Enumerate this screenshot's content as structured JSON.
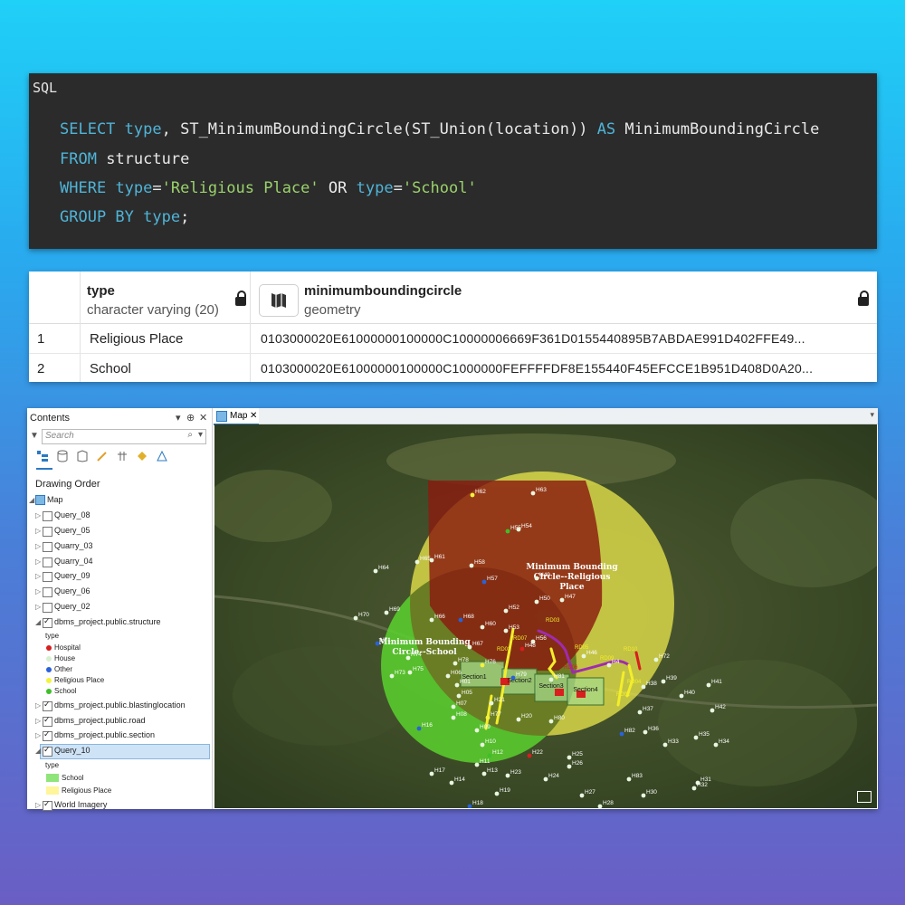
{
  "sql_panel": {
    "lang": "SQL",
    "line1_kw1": "SELECT",
    "line1_type": "type",
    "line1_rest": ", ST_MinimumBoundingCircle(ST_Union(location))",
    "line1_as": "AS",
    "line1_alias": "MinimumBoundingCircle",
    "line2_kw": "FROM",
    "line2_rest": "structure",
    "line3_kw": "WHERE",
    "line3_type1": "type",
    "line3_eq1": "=",
    "line3_str1": "'Religious Place'",
    "line3_or": "OR",
    "line3_type2": "type",
    "line3_eq2": "=",
    "line3_str2": "'School'",
    "line4_kw": "GROUP BY",
    "line4_type": "type",
    "line4_end": ";"
  },
  "result_grid": {
    "col1_name": "type",
    "col1_type": "character varying (20)",
    "col2_name": "minimumboundingcircle",
    "col2_type": "geometry",
    "rows": [
      {
        "num": "1",
        "type": "Religious Place",
        "geom": "0103000020E61000000100000C10000006669F361D0155440895B7ABDAE991D402FFE49..."
      },
      {
        "num": "2",
        "type": "School",
        "geom": "0103000020E61000000100000C1000000FEFFFFDF8E155440F45EFCCE1B951D408D0A20..."
      }
    ]
  },
  "contents_pane": {
    "title": "Contents",
    "search_placeholder": "Search",
    "drawing_order": "Drawing Order",
    "map_label": "Map",
    "layers": [
      "Query_08",
      "Query_05",
      "Quarry_03",
      "Quarry_04",
      "Query_09",
      "Query_06",
      "Query_02"
    ],
    "structure_layer": "dbms_project.public.structure",
    "type_label": "type",
    "structure_legend": [
      {
        "label": "Hospital",
        "color": "#d81e1e"
      },
      {
        "label": "House",
        "color": "#d8f0d0"
      },
      {
        "label": "Other",
        "color": "#2a62d8"
      },
      {
        "label": "Religious Place",
        "color": "#f3f33a"
      },
      {
        "label": "School",
        "color": "#3fbf2a"
      }
    ],
    "blasting_layer": "dbms_project.public.blastinglocation",
    "road_layer": "dbms_project.public.road",
    "section_layer": "dbms_project.public.section",
    "query10_layer": "Query_10",
    "query10_type": "type",
    "query10_legend": [
      {
        "label": "School",
        "color": "#8fe47a"
      },
      {
        "label": "Religious Place",
        "color": "#fff59a"
      }
    ],
    "imagery_layer": "World Imagery"
  },
  "map_pane": {
    "tab_label": "Map",
    "religious_label_1": "Minimum Bounding",
    "religious_label_2": "Circle--Religious",
    "religious_label_3": "Place",
    "school_label_1": "Minimum Bounding",
    "school_label_2": "Circle--School",
    "section_labels": [
      "Section1",
      "Section2",
      "Section3",
      "Section4"
    ],
    "points": [
      {
        "name": "H62",
        "c": "y"
      },
      {
        "name": "H63",
        "c": "w"
      },
      {
        "name": "H55",
        "c": "g"
      },
      {
        "name": "H54",
        "c": "w"
      },
      {
        "name": "H65",
        "c": "w"
      },
      {
        "name": "H61",
        "c": "w"
      },
      {
        "name": "H58",
        "c": "w"
      },
      {
        "name": "H64",
        "c": "w"
      },
      {
        "name": "H57",
        "c": "b"
      },
      {
        "name": "H49",
        "c": "w"
      },
      {
        "name": "H50",
        "c": "w"
      },
      {
        "name": "H47",
        "c": "w"
      },
      {
        "name": "H52",
        "c": "w"
      },
      {
        "name": "H70",
        "c": "w"
      },
      {
        "name": "H69",
        "c": "w"
      },
      {
        "name": "H66",
        "c": "w"
      },
      {
        "name": "H68",
        "c": "b"
      },
      {
        "name": "H60",
        "c": "w"
      },
      {
        "name": "H53",
        "c": "w"
      },
      {
        "name": "H71",
        "c": "b"
      },
      {
        "name": "H67",
        "c": "w"
      },
      {
        "name": "H56",
        "c": "w"
      },
      {
        "name": "H48",
        "c": "r"
      },
      {
        "name": "H74",
        "c": "w"
      },
      {
        "name": "H78",
        "c": "w"
      },
      {
        "name": "H76",
        "c": "y"
      },
      {
        "name": "H46",
        "c": "w"
      },
      {
        "name": "H72",
        "c": "w"
      },
      {
        "name": "H73",
        "c": "w"
      },
      {
        "name": "H75",
        "c": "w"
      },
      {
        "name": "H06",
        "c": "w"
      },
      {
        "name": "H79",
        "c": "b"
      },
      {
        "name": "H81",
        "c": "w"
      },
      {
        "name": "H4",
        "c": "w"
      },
      {
        "name": "H39",
        "c": "w"
      },
      {
        "name": "H01",
        "c": "w"
      },
      {
        "name": "H38",
        "c": "w"
      },
      {
        "name": "H41",
        "c": "w"
      },
      {
        "name": "H05",
        "c": "w"
      },
      {
        "name": "H40",
        "c": "w"
      },
      {
        "name": "H21",
        "c": "w"
      },
      {
        "name": "H07",
        "c": "w"
      },
      {
        "name": "H08",
        "c": "w"
      },
      {
        "name": "H77",
        "c": "y"
      },
      {
        "name": "H20",
        "c": "w"
      },
      {
        "name": "H80",
        "c": "w"
      },
      {
        "name": "H37",
        "c": "w"
      },
      {
        "name": "H42",
        "c": "w"
      },
      {
        "name": "H09",
        "c": "w"
      },
      {
        "name": "H16",
        "c": "b"
      },
      {
        "name": "H82",
        "c": "b"
      },
      {
        "name": "H36",
        "c": "w"
      },
      {
        "name": "H35",
        "c": "w"
      },
      {
        "name": "H10",
        "c": "w"
      },
      {
        "name": "H33",
        "c": "w"
      },
      {
        "name": "H34",
        "c": "w"
      },
      {
        "name": "H12",
        "c": "g"
      },
      {
        "name": "H22",
        "c": "r"
      },
      {
        "name": "H11",
        "c": "w"
      },
      {
        "name": "H25",
        "c": "w"
      },
      {
        "name": "H13",
        "c": "w"
      },
      {
        "name": "H23",
        "c": "w"
      },
      {
        "name": "H26",
        "c": "w"
      },
      {
        "name": "H17",
        "c": "w"
      },
      {
        "name": "H14",
        "c": "w"
      },
      {
        "name": "H24",
        "c": "w"
      },
      {
        "name": "H83",
        "c": "w"
      },
      {
        "name": "H31",
        "c": "w"
      },
      {
        "name": "H32",
        "c": "w"
      },
      {
        "name": "H19",
        "c": "w"
      },
      {
        "name": "H27",
        "c": "w"
      },
      {
        "name": "H30",
        "c": "w"
      },
      {
        "name": "H18",
        "c": "b"
      },
      {
        "name": "H28",
        "c": "w"
      }
    ],
    "road_labels": [
      "RD03",
      "RD10",
      "RD02",
      "RD06",
      "RD05",
      "RD09",
      "RD04",
      "RD01",
      "RD07"
    ]
  }
}
